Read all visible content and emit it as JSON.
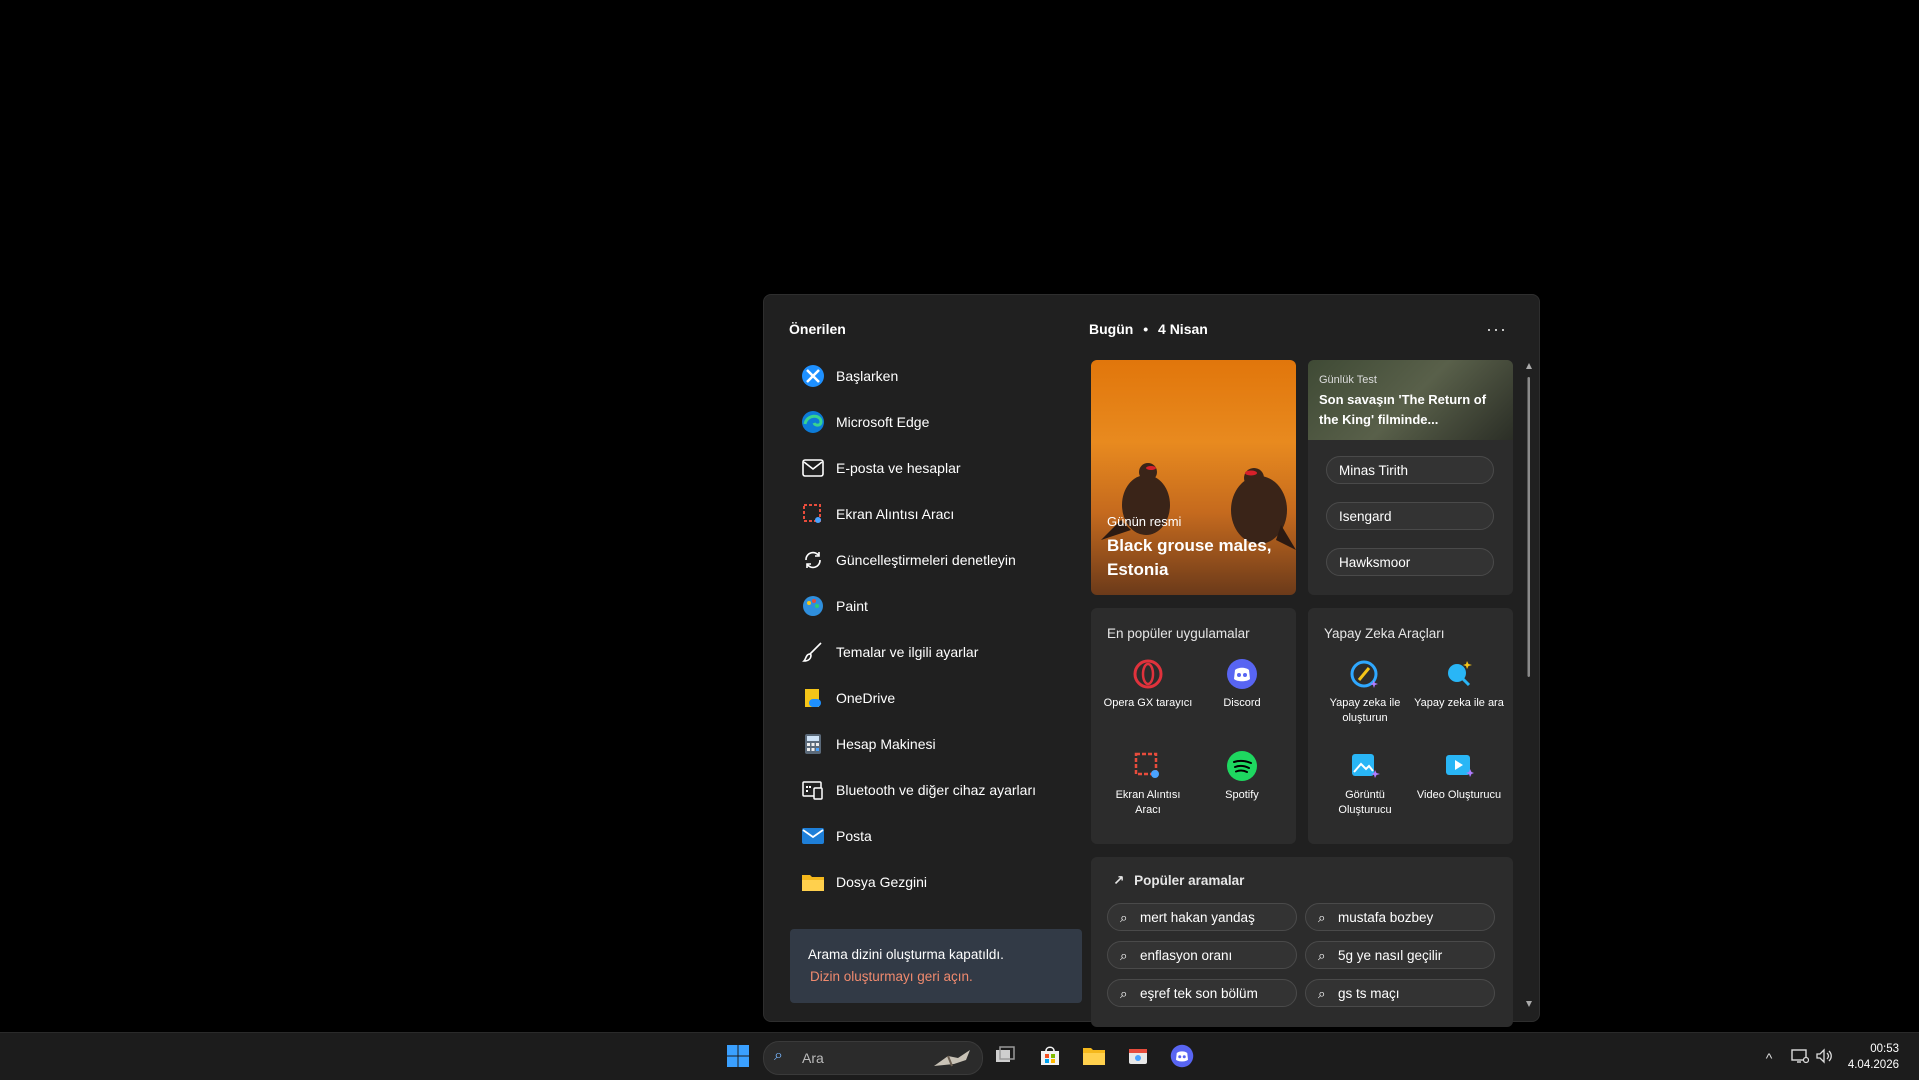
{
  "recommended": {
    "title": "Önerilen",
    "items": [
      {
        "label": "Başlarken",
        "icon": "get-started-icon"
      },
      {
        "label": "Microsoft Edge",
        "icon": "edge-icon"
      },
      {
        "label": "E-posta ve hesaplar",
        "icon": "mail-outline-icon"
      },
      {
        "label": "Ekran Alıntısı Aracı",
        "icon": "snipping-tool-icon"
      },
      {
        "label": "Güncelleştirmeleri denetleyin",
        "icon": "sync-icon"
      },
      {
        "label": "Paint",
        "icon": "paint-icon"
      },
      {
        "label": "Temalar ve ilgili ayarlar",
        "icon": "brush-icon"
      },
      {
        "label": "OneDrive",
        "icon": "onedrive-icon"
      },
      {
        "label": "Hesap Makinesi",
        "icon": "calculator-icon"
      },
      {
        "label": "Bluetooth ve diğer cihaz ayarları",
        "icon": "devices-icon"
      },
      {
        "label": "Posta",
        "icon": "mail-app-icon"
      },
      {
        "label": "Dosya Gezgini",
        "icon": "folder-icon"
      }
    ],
    "notice": {
      "text": "Arama dizini oluşturma kapatıldı.",
      "link": "Dizin oluşturmayı geri açın."
    }
  },
  "today": {
    "label": "Bugün",
    "date": "4 Nisan",
    "more": "···"
  },
  "photo_card": {
    "label": "Günün resmi",
    "title": "Black grouse males, Estonia"
  },
  "quiz_card": {
    "label": "Günlük Test",
    "title": "Son savaşın 'The Return of the King' filminde...",
    "options": [
      "Minas Tirith",
      "Isengard",
      "Hawksmoor"
    ]
  },
  "top_apps": {
    "title": "En popüler uygulamalar",
    "apps": [
      {
        "name": "Opera GX tarayıcı",
        "icon": "opera-gx-icon"
      },
      {
        "name": "Discord",
        "icon": "discord-icon"
      },
      {
        "name": "Ekran Alıntısı Aracı",
        "icon": "snipping-tool-icon"
      },
      {
        "name": "Spotify",
        "icon": "spotify-icon"
      }
    ]
  },
  "ai_tools": {
    "title": "Yapay Zeka Araçları",
    "tools": [
      {
        "name": "Yapay zeka ile oluşturun",
        "icon": "ai-create-icon"
      },
      {
        "name": "Yapay zeka ile ara",
        "icon": "ai-search-icon"
      },
      {
        "name": "Görüntü Oluşturucu",
        "icon": "image-creator-icon"
      },
      {
        "name": "Video Oluşturucu",
        "icon": "video-creator-icon"
      }
    ]
  },
  "popular_searches": {
    "title": "Popüler aramalar",
    "items": [
      "mert hakan yandaş",
      "mustafa bozbey",
      "enflasyon oranı",
      "5g ye nasıl geçilir",
      "eşref tek son bölüm",
      "gs ts maçı"
    ]
  },
  "taskbar": {
    "search_placeholder": "Ara",
    "time": "00:53",
    "date": "4.04.2026"
  },
  "colors": {
    "panel_bg": "#202020",
    "card_bg": "#2c2c2c",
    "link": "#f08a6e",
    "taskbar_bg": "#1c1c1c"
  }
}
